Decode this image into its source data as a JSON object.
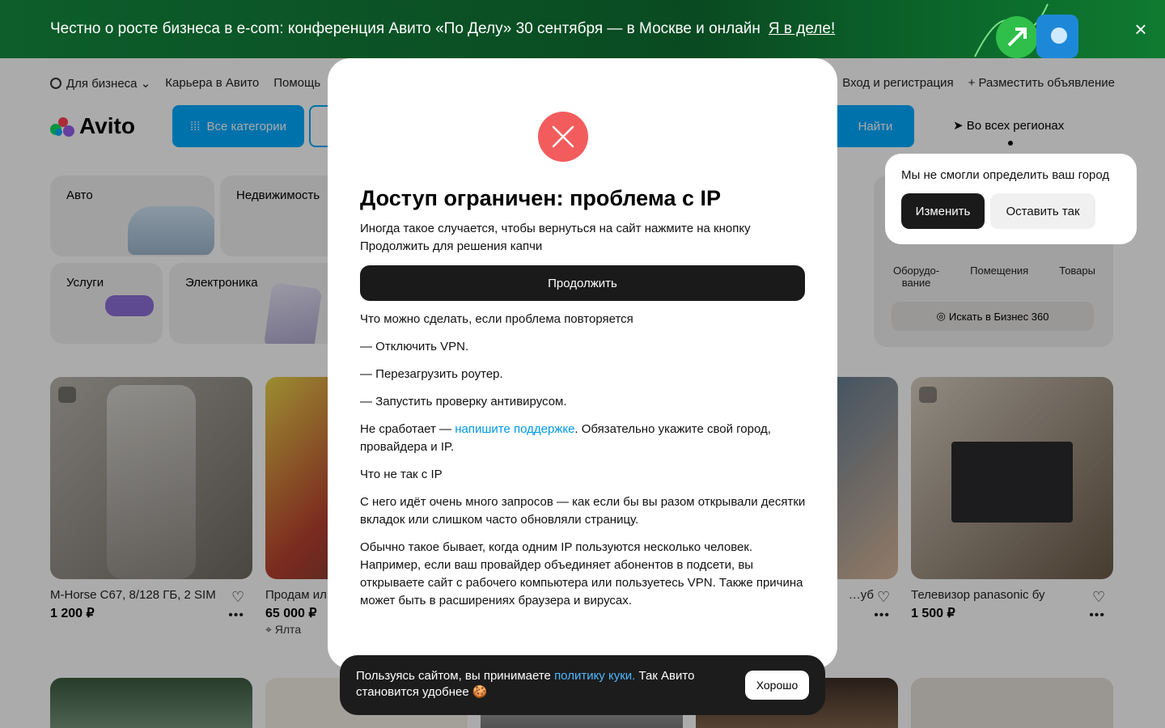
{
  "promo": {
    "text": "Честно о росте бизнеса в e-com: конференция Авито «По Делу» 30 сентября — в Москве и онлайн",
    "link": "Я в деле!",
    "close_icon": "close-icon"
  },
  "topnav": {
    "business": "Для бизнеса",
    "career": "Карьера в Авито",
    "help": "Помощь",
    "login": "Вход и регистрация",
    "post_ad": "Разместить объявление"
  },
  "header": {
    "logo": "Avito",
    "all_categories": "Все категории",
    "find": "Найти",
    "region": "Во всех регионах"
  },
  "categories": [
    {
      "label": "Авто"
    },
    {
      "label": "Недвижимость"
    },
    {
      "label": "Услуги"
    },
    {
      "label": "Электроника"
    }
  ],
  "business_panel": {
    "items": [
      "Оборудо-\nвание",
      "Помещения",
      "Товары"
    ],
    "search": "Искать в Бизнес 360"
  },
  "listings": [
    {
      "title": "M-Horse C67, 8/128 ГБ, 2 SIM",
      "price": "1 200 ₽",
      "location": ""
    },
    {
      "title": "Продам ил… готовый се…",
      "price": "65 000 ₽",
      "location": "Ялта"
    },
    {
      "title": "…уб",
      "price": "",
      "location": ""
    },
    {
      "title": "Телевизор panasonic бу",
      "price": "1 500 ₽",
      "location": ""
    }
  ],
  "modal": {
    "title": "Доступ ограничен: проблема с IP",
    "intro": "Иногда такое случается, чтобы вернуться на сайт нажмите на кнопку Продолжить для решения капчи",
    "continue": "Продолжить",
    "what_to_do": "Что можно сделать, если проблема повторяется",
    "step1": "— Отключить VPN.",
    "step2": "— Перезагрузить роутер.",
    "step3": "— Запустить проверку антивирусом.",
    "support_pre": "Не сработает — ",
    "support_link": "напишите поддержке",
    "support_post": ". Обязательно укажите свой город, провайдера и IP.",
    "whats_wrong": "Что не так с IP",
    "para1": "С него идёт очень много запросов — как если бы вы разом открывали десятки вкладок или слишком часто обновляли страницу.",
    "para2": "Обычно такое бывает, когда одним IP пользуются несколько человек. Например, если ваш провайдер объединяет абонентов в подсети, вы открываете сайт с рабочего компьютера или пользуетесь VPN. Также причина может быть в расширениях браузера и вирусах."
  },
  "city_popup": {
    "question": "Мы не смогли определить ваш город",
    "change": "Изменить",
    "keep": "Оставить так"
  },
  "cookie": {
    "pre": "Пользуясь сайтом, вы принимаете ",
    "link": "политику куки.",
    "post": " Так Авито становится удобнее 🍪",
    "ok": "Хорошо"
  },
  "colors": {
    "accent": "#00aaff",
    "error": "#f25c5c",
    "dark": "#1a1a1a"
  }
}
